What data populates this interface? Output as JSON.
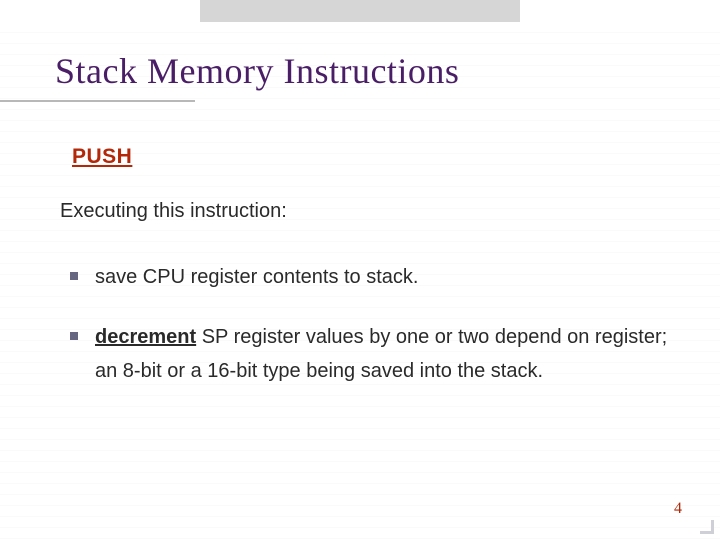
{
  "slide": {
    "title": "Stack Memory  Instructions",
    "section_label": "PUSH",
    "intro": "Executing this instruction:",
    "bullets": [
      {
        "prefix": "",
        "bold_underline": "",
        "rest": "save CPU register contents to stack."
      },
      {
        "prefix": "",
        "bold_underline": "decrement",
        "rest": " SP register values by one or two depend on register; an 8-bit or a 16-bit type being saved into the stack."
      }
    ],
    "page_number": "4"
  }
}
